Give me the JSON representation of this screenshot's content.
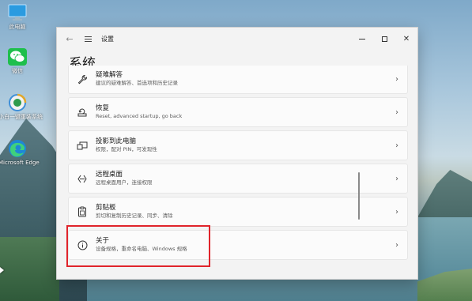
{
  "desktop": {
    "icons": [
      {
        "name": "this-pc",
        "label": "此电脑"
      },
      {
        "name": "wechat",
        "label": "微信"
      },
      {
        "name": "xiaobai",
        "label": "小白一键重装系统"
      },
      {
        "name": "edge",
        "label": "Microsoft Edge"
      }
    ]
  },
  "window": {
    "app_title": "设置",
    "page_title": "系统",
    "controls": {
      "minimize": "—",
      "maximize": "□",
      "close": "✕"
    },
    "items": [
      {
        "title": "疑难解答",
        "desc": "建议的疑难解答、首选项和历史记录",
        "icon": "wrench-icon"
      },
      {
        "title": "恢复",
        "desc": "Reset, advanced startup, go back",
        "icon": "recovery-icon"
      },
      {
        "title": "投影到此电脑",
        "desc": "权限，配对 PIN，可发现性",
        "icon": "projector-icon"
      },
      {
        "title": "远程桌面",
        "desc": "远程桌面用户，连接权限",
        "icon": "remote-desktop-icon"
      },
      {
        "title": "剪贴板",
        "desc": "剪切和复制历史记录、同步、清除",
        "icon": "clipboard-icon"
      },
      {
        "title": "关于",
        "desc": "设备规格，重命名电脑、Windows 规格",
        "icon": "info-icon"
      }
    ],
    "chevron": "›"
  },
  "colors": {
    "highlight": "#e0242b",
    "window_bg": "#f3f3f3",
    "card_bg": "#fbfbfb"
  }
}
